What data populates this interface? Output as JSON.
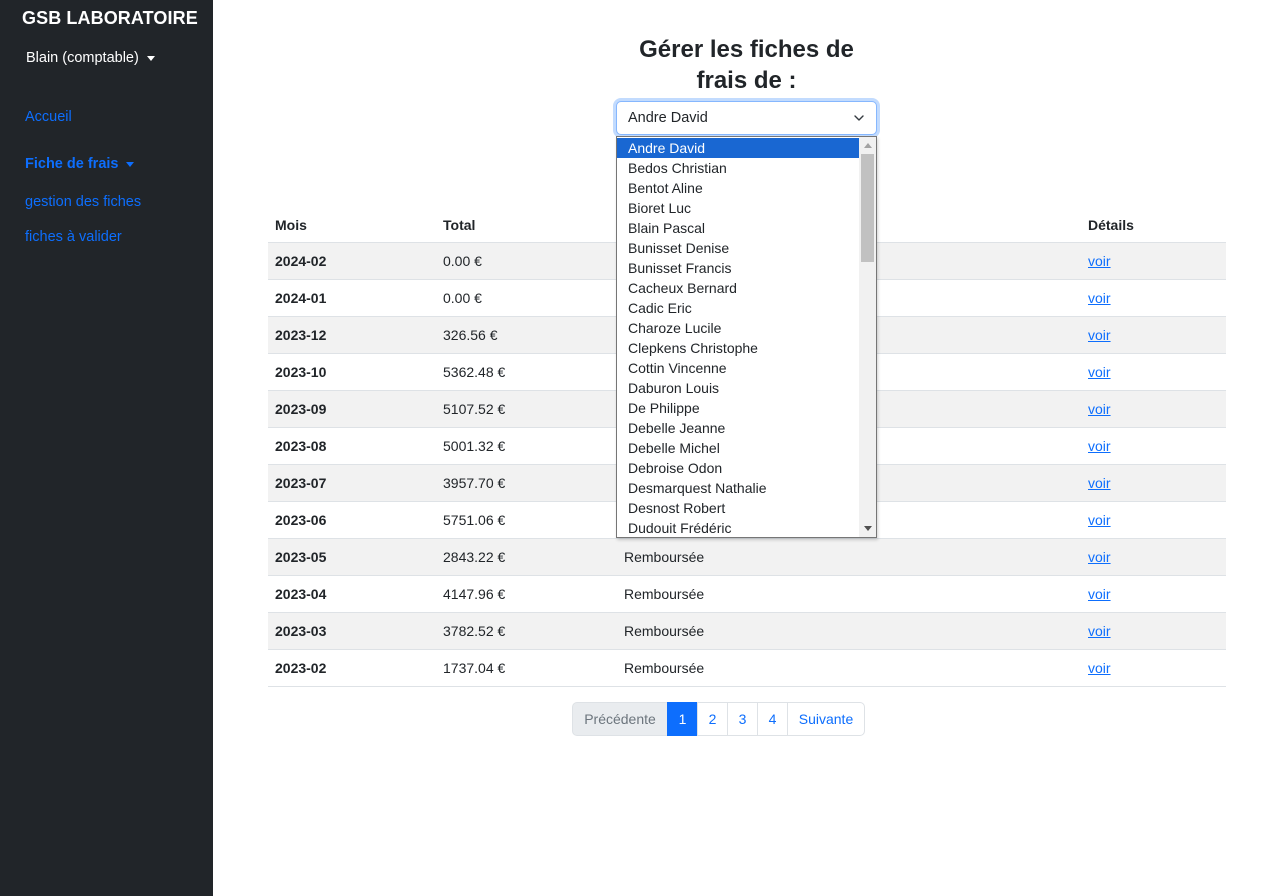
{
  "sidebar": {
    "brand": "GSB LABORATOIRE",
    "user": "Blain (comptable)",
    "nav": {
      "accueil": "Accueil",
      "fiche_frais": "Fiche de frais",
      "gestion": "gestion des fiches",
      "valider": "fiches à valider"
    }
  },
  "main": {
    "title": "Gérer les fiches de frais de :",
    "select": {
      "value": "Andre David",
      "options": [
        "Andre David",
        "Bedos Christian",
        "Bentot Aline",
        "Bioret Luc",
        "Blain Pascal",
        "Bunisset Denise",
        "Bunisset Francis",
        "Cacheux Bernard",
        "Cadic Eric",
        "Charoze Lucile",
        "Clepkens Christophe",
        "Cottin Vincenne",
        "Daburon Louis",
        "De Philippe",
        "Debelle Jeanne",
        "Debelle Michel",
        "Debroise Odon",
        "Desmarquest Nathalie",
        "Desnost Robert",
        "Dudouit Frédéric"
      ]
    },
    "table": {
      "headers": [
        "Mois",
        "Total",
        "",
        "Détails"
      ],
      "rows": [
        {
          "mois": "2024-02",
          "total": "0.00 €",
          "etat": "",
          "details": "voir"
        },
        {
          "mois": "2024-01",
          "total": "0.00 €",
          "etat": "",
          "details": "voir"
        },
        {
          "mois": "2023-12",
          "total": "326.56 €",
          "etat": "",
          "details": "voir"
        },
        {
          "mois": "2023-10",
          "total": "5362.48 €",
          "etat": "",
          "details": "voir"
        },
        {
          "mois": "2023-09",
          "total": "5107.52 €",
          "etat": "",
          "details": "voir"
        },
        {
          "mois": "2023-08",
          "total": "5001.32 €",
          "etat": "",
          "details": "voir"
        },
        {
          "mois": "2023-07",
          "total": "3957.70 €",
          "etat": "",
          "details": "voir"
        },
        {
          "mois": "2023-06",
          "total": "5751.06 €",
          "etat": "",
          "details": "voir"
        },
        {
          "mois": "2023-05",
          "total": "2843.22 €",
          "etat": "Remboursée",
          "details": "voir"
        },
        {
          "mois": "2023-04",
          "total": "4147.96 €",
          "etat": "Remboursée",
          "details": "voir"
        },
        {
          "mois": "2023-03",
          "total": "3782.52 €",
          "etat": "Remboursée",
          "details": "voir"
        },
        {
          "mois": "2023-02",
          "total": "1737.04 €",
          "etat": "Remboursée",
          "details": "voir"
        }
      ]
    },
    "pagination": {
      "prev": "Précédente",
      "pages": [
        "1",
        "2",
        "3",
        "4"
      ],
      "active": "1",
      "next": "Suivante"
    }
  },
  "colors": {
    "sidebar_bg": "#212529",
    "accent": "#0d6efd",
    "option_selected": "#1967d2"
  }
}
